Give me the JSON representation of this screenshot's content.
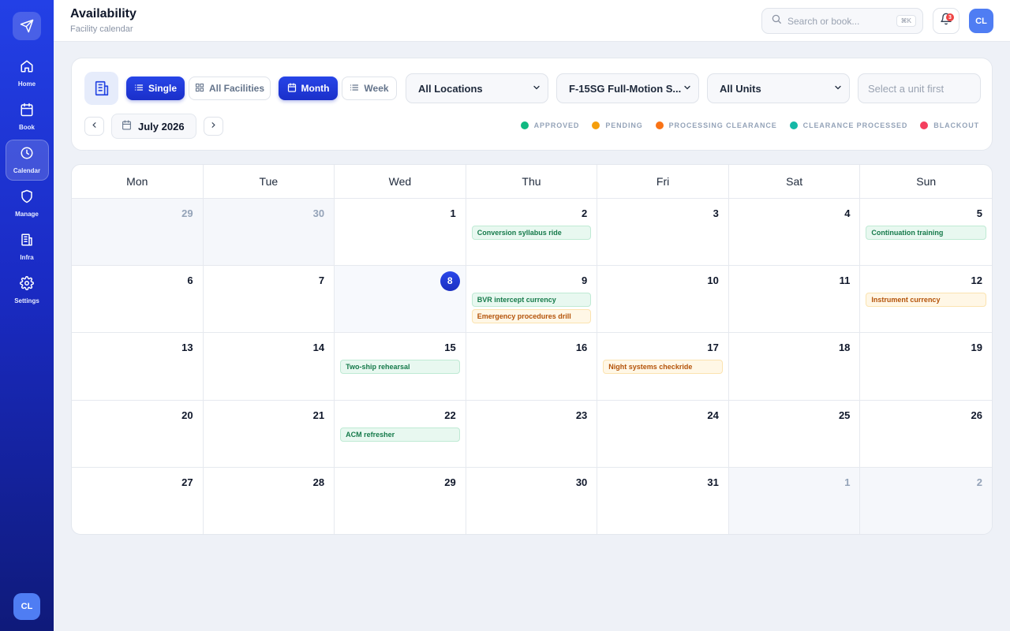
{
  "sidebar": {
    "items": [
      {
        "label": "Home",
        "icon": "home-icon"
      },
      {
        "label": "Book",
        "icon": "calendar-icon"
      },
      {
        "label": "Calendar",
        "icon": "clock-icon",
        "active": true
      },
      {
        "label": "Manage",
        "icon": "shield-icon"
      },
      {
        "label": "Infra",
        "icon": "building-icon"
      },
      {
        "label": "Settings",
        "icon": "gear-icon"
      }
    ],
    "avatar": "CL"
  },
  "header": {
    "title": "Availability",
    "subtitle": "Facility calendar",
    "search_placeholder": "Search or book...",
    "search_shortcut": "⌘K",
    "notification_count": "3",
    "avatar": "CL"
  },
  "toolbar": {
    "single": "Single",
    "all_facilities": "All Facilities",
    "month": "Month",
    "week": "Week",
    "location": "All Locations",
    "facility": "F-15SG Full-Motion S...",
    "units": "All Units",
    "unit_placeholder": "Select a unit first",
    "current_month": "July 2026"
  },
  "legend": [
    {
      "label": "APPROVED",
      "color": "#10b981"
    },
    {
      "label": "PENDING",
      "color": "#f59e0b"
    },
    {
      "label": "PROCESSING CLEARANCE",
      "color": "#f97316"
    },
    {
      "label": "CLEARANCE PROCESSED",
      "color": "#14b8a6"
    },
    {
      "label": "BLACKOUT",
      "color": "#f43f5e"
    }
  ],
  "calendar": {
    "weekdays": [
      "Mon",
      "Tue",
      "Wed",
      "Thu",
      "Fri",
      "Sat",
      "Sun"
    ],
    "today": 8,
    "days": [
      {
        "d": "29",
        "outside": true
      },
      {
        "d": "30",
        "outside": true
      },
      {
        "d": "1"
      },
      {
        "d": "2",
        "events": [
          {
            "title": "Conversion syllabus ride",
            "status": "approved"
          }
        ]
      },
      {
        "d": "3"
      },
      {
        "d": "4"
      },
      {
        "d": "5",
        "events": [
          {
            "title": "Continuation training",
            "status": "approved"
          }
        ]
      },
      {
        "d": "6"
      },
      {
        "d": "7"
      },
      {
        "d": "8",
        "today": true
      },
      {
        "d": "9",
        "events": [
          {
            "title": "BVR intercept currency",
            "status": "approved"
          },
          {
            "title": "Emergency procedures drill",
            "status": "pending"
          }
        ]
      },
      {
        "d": "10"
      },
      {
        "d": "11"
      },
      {
        "d": "12",
        "events": [
          {
            "title": "Instrument currency",
            "status": "pending"
          }
        ]
      },
      {
        "d": "13"
      },
      {
        "d": "14"
      },
      {
        "d": "15",
        "events": [
          {
            "title": "Two-ship rehearsal",
            "status": "approved"
          }
        ]
      },
      {
        "d": "16"
      },
      {
        "d": "17",
        "events": [
          {
            "title": "Night systems checkride",
            "status": "pending"
          }
        ]
      },
      {
        "d": "18"
      },
      {
        "d": "19"
      },
      {
        "d": "20"
      },
      {
        "d": "21"
      },
      {
        "d": "22",
        "events": [
          {
            "title": "ACM refresher",
            "status": "approved"
          }
        ]
      },
      {
        "d": "23"
      },
      {
        "d": "24"
      },
      {
        "d": "25"
      },
      {
        "d": "26"
      },
      {
        "d": "27"
      },
      {
        "d": "28"
      },
      {
        "d": "29"
      },
      {
        "d": "30"
      },
      {
        "d": "31"
      },
      {
        "d": "1",
        "outside": true
      },
      {
        "d": "2",
        "outside": true
      }
    ]
  }
}
